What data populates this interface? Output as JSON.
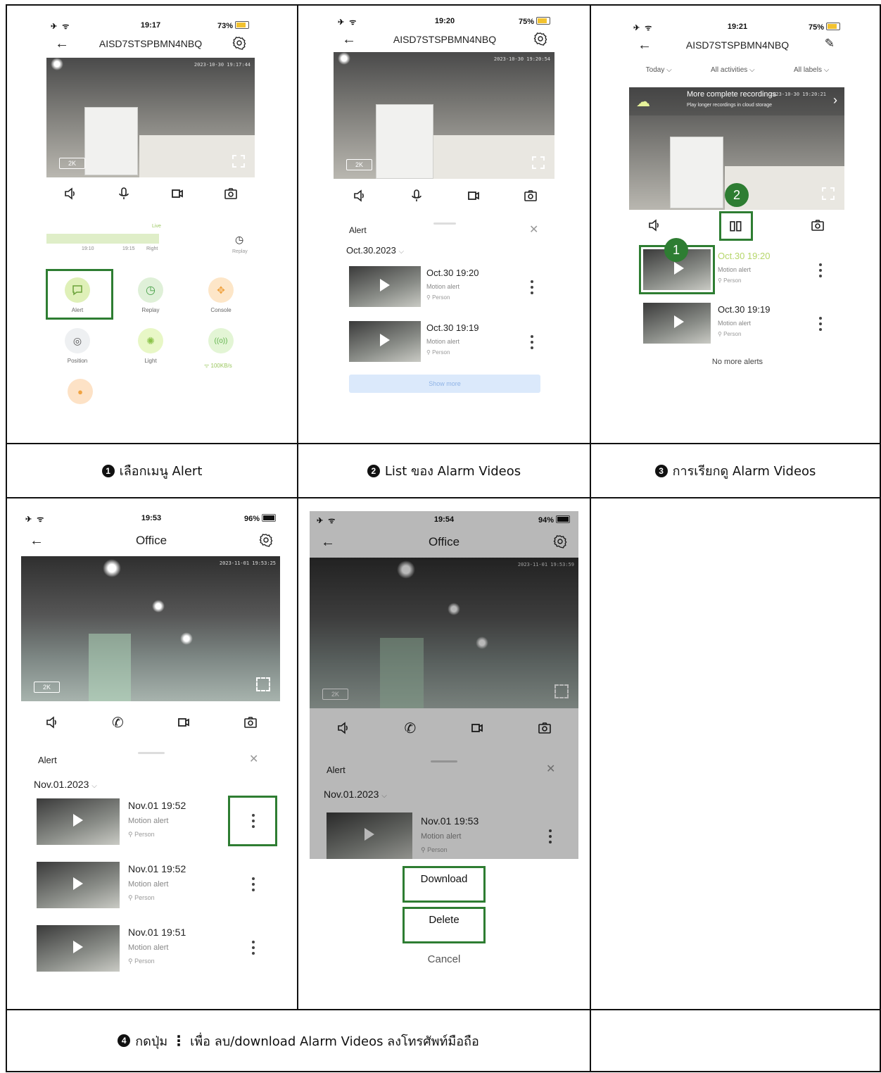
{
  "captions": {
    "c1": {
      "badge": "1",
      "text": "เลือกเมนู Alert"
    },
    "c2": {
      "badge": "2",
      "text": "List ของ Alarm Videos"
    },
    "c3": {
      "badge": "3",
      "text": "การเรียกดู Alarm Videos"
    },
    "c4": {
      "badge": "4",
      "pre": "กดปุ่ม",
      "dots": "⋮",
      "text": "เพื่อ ลบ/download Alarm Videos ลงโทรศัพท์มือถือ"
    }
  },
  "colors": {
    "highlight": "#2e7d32",
    "accent_green": "#a7d36f",
    "show_more_bg": "#dbe9fb"
  },
  "p1": {
    "status": {
      "time": "19:17",
      "battery": "73%"
    },
    "title": "AISD7STSPBMN4NBQ",
    "video": {
      "timestamp": "2023-10-30 19:17:44",
      "quality": "2K"
    },
    "timeline": {
      "t1": "19:10",
      "t2": "19:15",
      "right": "Right",
      "live": "Live",
      "replay": "Replay"
    },
    "menu": [
      {
        "label": "Alert",
        "icon": "alert-icon"
      },
      {
        "label": "Replay",
        "icon": "replay-icon"
      },
      {
        "label": "Console",
        "icon": "console-icon"
      },
      {
        "label": "Position",
        "icon": "position-icon"
      },
      {
        "label": "Light",
        "icon": "light-icon"
      },
      {
        "label": "",
        "icon": "signal-icon"
      }
    ],
    "speed": "100KB/s"
  },
  "p2": {
    "status": {
      "time": "19:20",
      "battery": "75%"
    },
    "title": "AISD7STSPBMN4NBQ",
    "video": {
      "timestamp": "2023-10-30 19:20:54",
      "quality": "2K"
    },
    "sheet_title": "Alert",
    "date": "Oct.30.2023",
    "rows": [
      {
        "time": "Oct.30 19:20",
        "type": "Motion alert",
        "tag": "Person"
      },
      {
        "time": "Oct.30 19:19",
        "type": "Motion alert",
        "tag": "Person"
      }
    ],
    "show_more": "Show more"
  },
  "p3": {
    "status": {
      "time": "19:21",
      "battery": "75%"
    },
    "title": "AISD7STSPBMN4NBQ",
    "filters": [
      "Today",
      "All activities",
      "All labels"
    ],
    "banner": {
      "title": "More complete recordings",
      "sub": "Play longer recordings in cloud storage",
      "timestamp": "2023-10-30 19:20:21"
    },
    "rows": [
      {
        "time": "Oct.30 19:20",
        "type": "Motion alert",
        "tag": "Person"
      },
      {
        "time": "Oct.30 19:19",
        "type": "Motion alert",
        "tag": "Person"
      }
    ],
    "no_more": "No more alerts",
    "markers": [
      "1",
      "2"
    ]
  },
  "p4": {
    "status": {
      "time": "19:53",
      "battery": "96%"
    },
    "title": "Office",
    "video": {
      "timestamp": "2023-11-01 19:53:25",
      "quality": "2K"
    },
    "sheet_title": "Alert",
    "date": "Nov.01.2023",
    "rows": [
      {
        "time": "Nov.01 19:52",
        "type": "Motion alert",
        "tag": "Person"
      },
      {
        "time": "Nov.01 19:52",
        "type": "Motion alert",
        "tag": "Person"
      },
      {
        "time": "Nov.01 19:51",
        "type": "Motion alert",
        "tag": "Person"
      }
    ]
  },
  "p5": {
    "status": {
      "time": "19:54",
      "battery": "94%"
    },
    "title": "Office",
    "video": {
      "timestamp": "2023-11-01 19:53:59",
      "quality": "2K"
    },
    "sheet_title": "Alert",
    "date": "Nov.01.2023",
    "rows": [
      {
        "time": "Nov.01 19:53",
        "type": "Motion alert",
        "tag": "Person"
      }
    ],
    "actions": {
      "download": "Download",
      "delete": "Delete",
      "cancel": "Cancel"
    }
  }
}
